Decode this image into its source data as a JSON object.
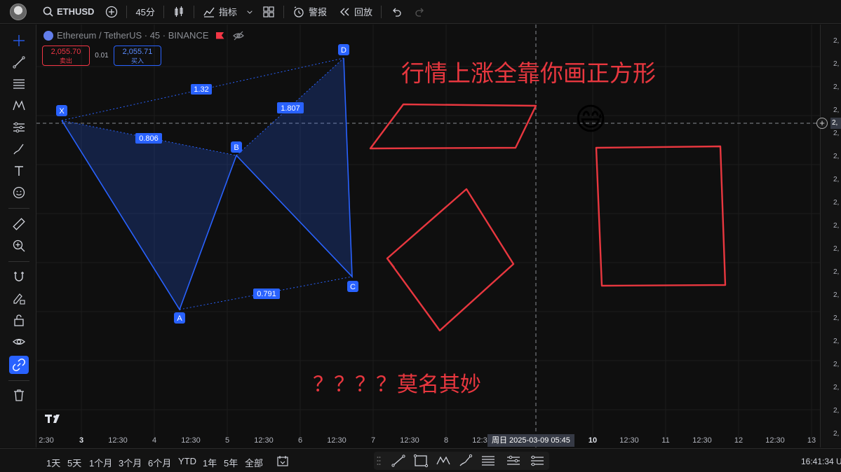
{
  "topbar": {
    "symbol": "ETHUSD",
    "interval": "45分",
    "indicators": "指标",
    "alerts": "警报",
    "replay": "回放"
  },
  "legend": {
    "title": "Ethereum / TetherUS · 45 · BINANCE"
  },
  "prices": {
    "sell_value": "2,055.70",
    "sell_label": "卖出",
    "spread": "0.01",
    "buy_value": "2,055.71",
    "buy_label": "买入"
  },
  "pattern": {
    "points": {
      "x": "X",
      "a": "A",
      "b": "B",
      "c": "C",
      "d": "D"
    },
    "ratios": {
      "xd": "1.32",
      "xb": "0.806",
      "bd": "1.807",
      "ac": "0.791"
    },
    "color": "#2962ff"
  },
  "annotations": {
    "headline": "行情上涨全靠你画正方形",
    "question": "？？？？莫名其妙",
    "emoji": "😅",
    "color": "#e8373f"
  },
  "time_axis": {
    "ticks": [
      "2:30",
      "3",
      "12:30",
      "4",
      "12:30",
      "5",
      "12:30",
      "6",
      "12:30",
      "7",
      "12:30",
      "8",
      "12:3",
      "10",
      "12:30",
      "11",
      "12:30",
      "12",
      "12:30",
      "13"
    ],
    "bold_ticks": [
      "3",
      "10"
    ],
    "crosshair": "周日 2025-03-09   05:45"
  },
  "price_scale": {
    "ticks": [
      "2,",
      "2,",
      "2,",
      "2,",
      "2,",
      "2,",
      "2,",
      "2,",
      "2,",
      "2,",
      "2,",
      "2,",
      "2,",
      "2,",
      "2,",
      "2,",
      "2,",
      "2,"
    ],
    "crosshair": "2,"
  },
  "bottombar": {
    "ranges": [
      "1天",
      "5天",
      "1个月",
      "3个月",
      "6个月",
      "YTD",
      "1年",
      "5年",
      "全部"
    ],
    "clock": "16:41:34 U"
  },
  "logo": "TV"
}
